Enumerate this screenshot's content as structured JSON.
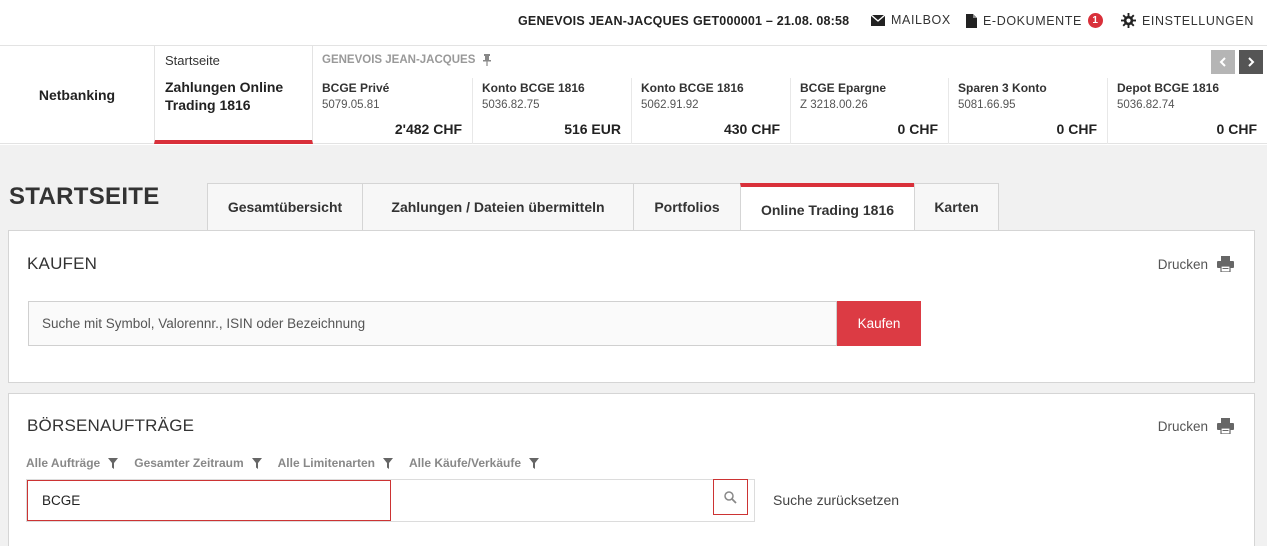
{
  "topbar": {
    "user_name": "GENEVOIS JEAN-JACQUES",
    "session": "GET000001 – 21.08. 08:58",
    "mailbox": "MAILBOX",
    "edocuments": "E-DOKUMENTE",
    "edocuments_badge": "1",
    "settings": "EINSTELLUNGEN"
  },
  "accountbar": {
    "netbanking": "Netbanking",
    "start_label": "Startseite",
    "start_sub": "Zahlungen Online Trading 1816",
    "owner": "GENEVOIS JEAN-JACQUES",
    "accounts": [
      {
        "name": "BCGE Privé",
        "number": "5079.05.81",
        "amount": "2'482 CHF"
      },
      {
        "name": "Konto BCGE 1816",
        "number": "5036.82.75",
        "amount": "516 EUR"
      },
      {
        "name": "Konto BCGE 1816",
        "number": "5062.91.92",
        "amount": "430 CHF"
      },
      {
        "name": "BCGE Epargne",
        "number": "Z 3218.00.26",
        "amount": "0 CHF"
      },
      {
        "name": "Sparen 3 Konto",
        "number": "5081.66.95",
        "amount": "0 CHF"
      },
      {
        "name": "Depot BCGE 1816",
        "number": "5036.82.74",
        "amount": "0 CHF"
      }
    ]
  },
  "page": {
    "title": "STARTSEITE",
    "tabs": [
      {
        "label": "Gesamtübersicht"
      },
      {
        "label": "Zahlungen / Dateien übermitteln"
      },
      {
        "label": "Portfolios"
      },
      {
        "label": "Online Trading 1816",
        "active": true
      },
      {
        "label": "Karten"
      }
    ]
  },
  "kaufen": {
    "title": "KAUFEN",
    "print": "Drucken",
    "search_placeholder": "Suche mit Symbol, Valorennr., ISIN oder Bezeichnung",
    "button": "Kaufen"
  },
  "orders": {
    "title": "BÖRSENAUFTRÄGE",
    "print": "Drucken",
    "filters": [
      "Alle Aufträge",
      "Gesamter Zeitraum",
      "Alle Limitenarten",
      "Alle Käufe/Verkäufe"
    ],
    "search_value": "BCGE",
    "reset": "Suche zurücksetzen"
  },
  "colors": {
    "accent": "#d9303a",
    "button": "#dc3b44",
    "background": "#f1f1f1"
  }
}
